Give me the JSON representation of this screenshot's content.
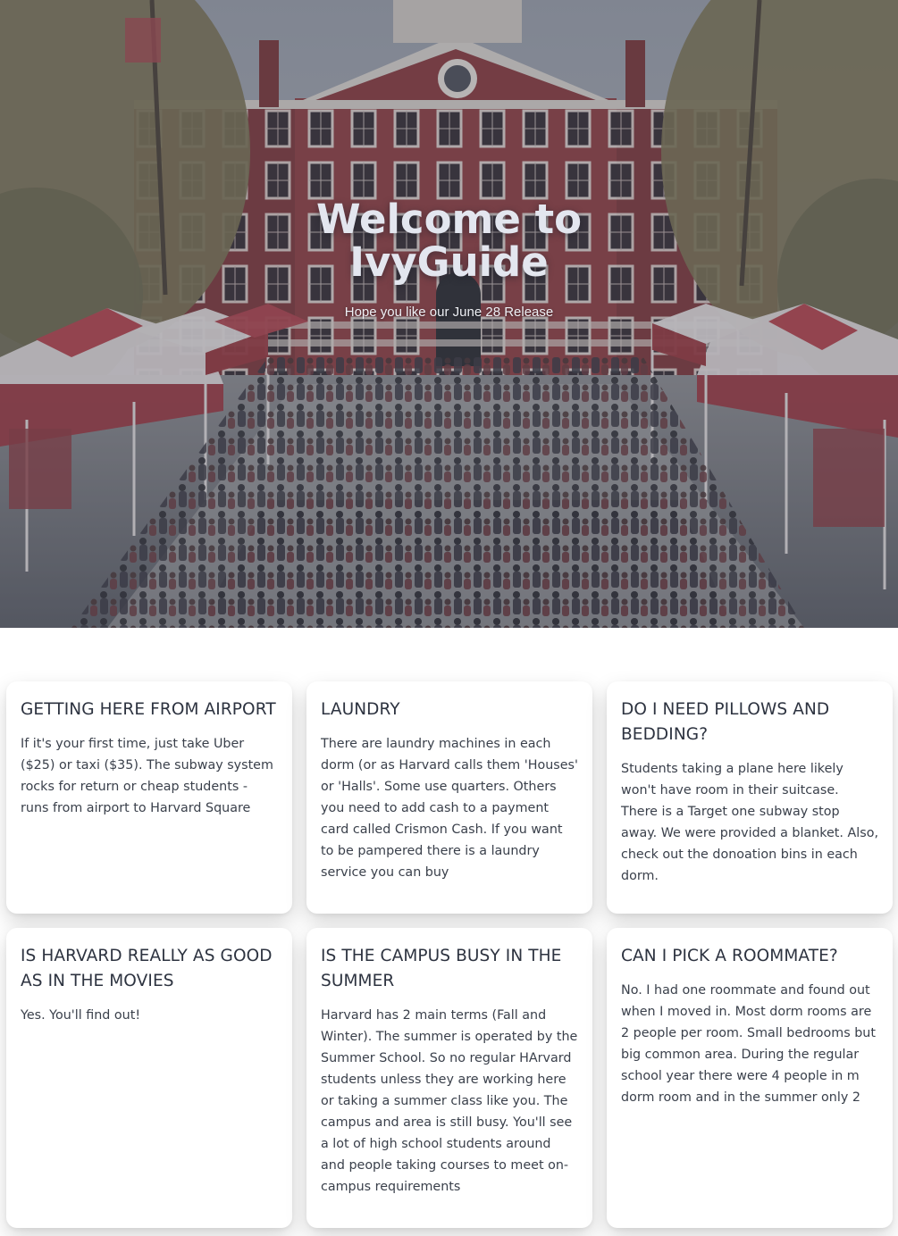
{
  "hero": {
    "title_line1": "Welcome to",
    "title_line2": "IvyGuide",
    "subtitle": "Hope you like our June 28 Release"
  },
  "cards": [
    {
      "title": "GETTING HERE FROM AIRPORT",
      "body": "If it's your first time, just take Uber ($25) or taxi ($35). The subway system rocks for return or cheap students - runs from airport to Harvard Square"
    },
    {
      "title": "LAUNDRY",
      "body": "There are laundry machines in each dorm (or as Harvard calls them 'Houses' or 'Halls'. Some use quarters. Others you need to add cash to a payment card called Crismon Cash. If you want to be pampered there is a laundry service you can buy"
    },
    {
      "title": "DO I NEED PILLOWS AND BEDDING?",
      "body": "Students taking a plane here likely won't have room in their suitcase. There is a Target one subway stop away. We were provided a blanket. Also, check out the donoation bins in each dorm."
    },
    {
      "title": "IS HARVARD REALLY AS GOOD AS IN THE MOVIES",
      "body": "Yes. You'll find out!"
    },
    {
      "title": "IS THE CAMPUS BUSY IN THE SUMMER",
      "body": "Harvard has 2 main terms (Fall and Winter). The summer is operated by the Summer School. So no regular HArvard students unless they are working here or taking a summer class like you. The campus and area is still busy. You'll see a lot of high school students around and people taking courses to meet on-campus requirements"
    },
    {
      "title": "CAN I PICK A ROOMMATE?",
      "body": "No. I had one roommate and found out when I moved in. Most dorm rooms are 2 people per room. Small bedrooms but big common area. During the regular school year there were 4 people in m dorm room and in the summer only 2"
    }
  ],
  "colors": {
    "brick": "#8a3b3f",
    "tent_red": "#a8404a",
    "overlay": "#3c404e",
    "card_bg": "#ffffff",
    "text": "#2d3340"
  }
}
